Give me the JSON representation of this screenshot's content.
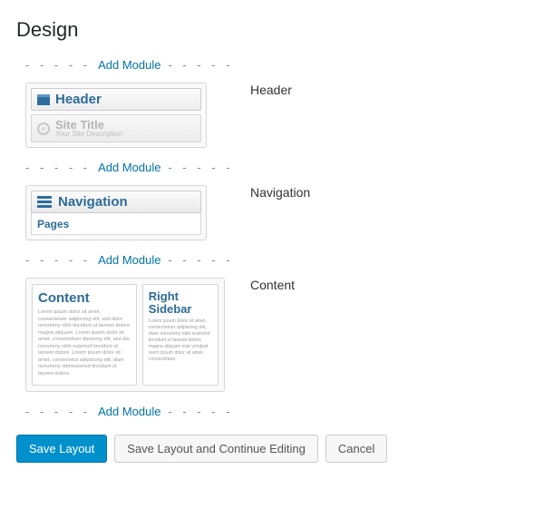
{
  "page": {
    "title": "Design"
  },
  "addModule": {
    "dashesLeft": "- - - - -",
    "dashesRight": "- - - - -",
    "label": "Add Module"
  },
  "sections": {
    "header": {
      "label": "Header",
      "preview": {
        "headerTitle": "Header",
        "siteTitle": "Site Title",
        "siteDescription": "Your Site Description"
      }
    },
    "navigation": {
      "label": "Navigation",
      "preview": {
        "navTitle": "Navigation",
        "pages": "Pages"
      }
    },
    "content": {
      "label": "Content",
      "preview": {
        "mainHeading": "Content",
        "sideHeading": "Right Sidebar",
        "mainLorem": "Lorem ipsum dolor sit amet, consectetuer adipiscing elit, sed diam nonummy nibh tincidunt ut laoreet dolore magna aliquam. Lorem ipsum dolor sit amet, consectetuer dipiscing elit, sed dia nonummy nibh euismod tincidunt ut laoreet dolore. Lorem ipsum dolor sit amet, consectetur adipiscing elit, diam nonummy nibheuismod tincidunt ut laoreet dolore.",
        "sideLorem": "Lorem ipsum dolor sit amet, consectetuer adipiscing elit, diam nonummy nibh euismod tincidunt ut laoreet dolore magna aliquam erat volutpat orem ipsum dolor sit amet, consectetuer."
      }
    }
  },
  "buttons": {
    "save": "Save Layout",
    "saveContinue": "Save Layout and Continue Editing",
    "cancel": "Cancel"
  }
}
